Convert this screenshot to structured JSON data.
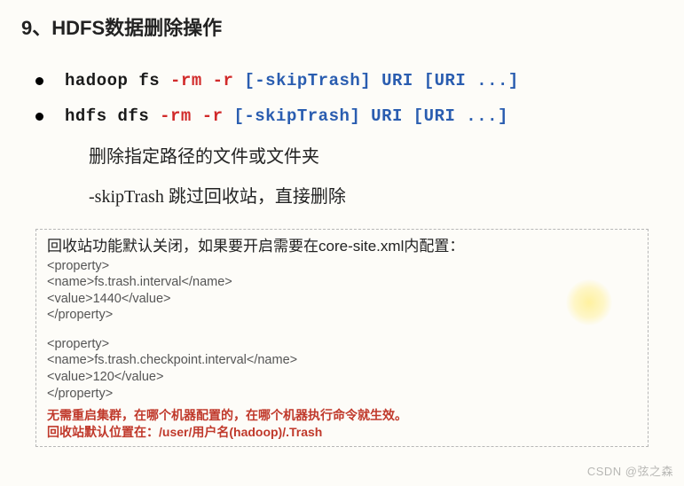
{
  "title": "9、HDFS数据删除操作",
  "bullets": [
    {
      "prefix": "hadoop fs ",
      "flags": "-rm -r ",
      "args": "[-skipTrash] URI [URI ...]"
    },
    {
      "prefix": "hdfs dfs ",
      "flags": "-rm -r ",
      "args": "[-skipTrash] URI [URI ...]"
    }
  ],
  "notes": {
    "n1": "删除指定路径的文件或文件夹",
    "n2": "-skipTrash 跳过回收站，直接删除"
  },
  "box": {
    "intro": "回收站功能默认关闭，如果要开启需要在core-site.xml内配置：",
    "xml1": [
      "<property>",
      "<name>fs.trash.interval</name>",
      "<value>1440</value>",
      "</property>"
    ],
    "xml2": [
      "<property>",
      "<name>fs.trash.checkpoint.interval</name>",
      "<value>120</value>",
      "</property>"
    ],
    "foot1": "无需重启集群，在哪个机器配置的，在哪个机器执行命令就生效。",
    "foot2": "回收站默认位置在：/user/用户名(hadoop)/.Trash"
  },
  "watermark": "CSDN @弦之森"
}
